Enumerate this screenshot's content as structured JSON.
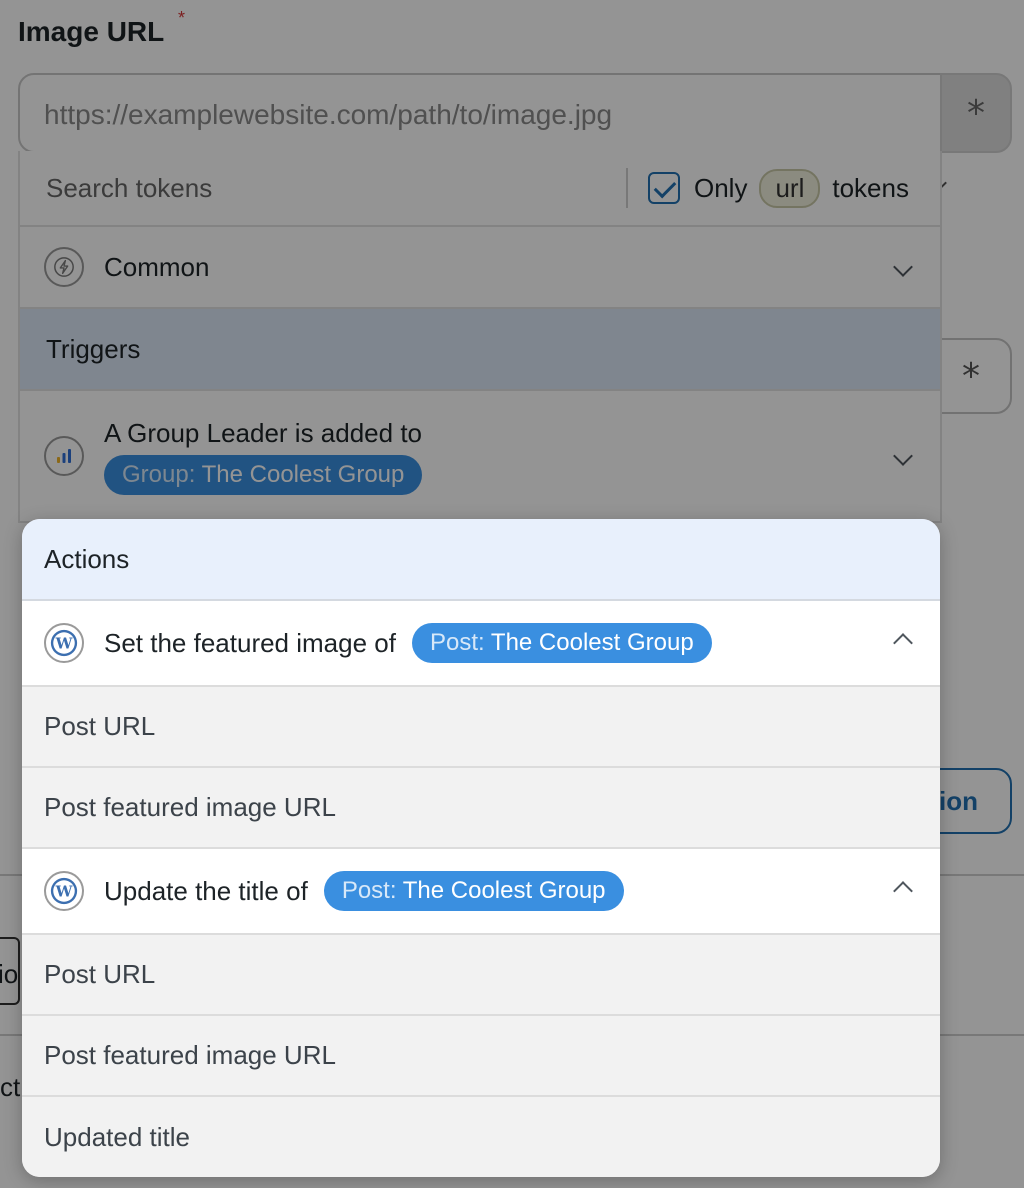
{
  "field": {
    "label": "Image URL",
    "required_mark": "*",
    "placeholder": "https://examplewebsite.com/path/to/image.jpg",
    "token_button": "*"
  },
  "background": {
    "token_button_2": "*",
    "action_button_partial": "ion",
    "left_tab_partial": "io",
    "left_text_partial": "ct"
  },
  "token_selector": {
    "search_placeholder": "Search tokens",
    "filter": {
      "prefix": "Only",
      "pill": "url",
      "suffix": "tokens",
      "checked": true
    },
    "groups": {
      "common": {
        "label": "Common",
        "icon": "bolt-icon"
      },
      "triggers": {
        "heading": "Triggers",
        "items": [
          {
            "label": "A Group Leader is added to",
            "badge_key": "Group:",
            "badge_value": "The Coolest Group",
            "icon": "learndash-icon"
          }
        ]
      },
      "actions": {
        "heading": "Actions",
        "items": [
          {
            "label": "Set the featured image of",
            "badge_key": "Post:",
            "badge_value": "The Coolest Group",
            "icon": "wordpress-icon",
            "tokens": [
              "Post URL",
              "Post featured image URL"
            ]
          },
          {
            "label": "Update the title of",
            "badge_key": "Post:",
            "badge_value": "The Coolest Group",
            "icon": "wordpress-icon",
            "tokens": [
              "Post URL",
              "Post featured image URL",
              "Updated title"
            ]
          }
        ]
      }
    }
  },
  "colors": {
    "accent": "#2271b1",
    "badge": "#3a8fe0",
    "triggers_header": "#dbe7f7",
    "actions_header": "#e8f0fc"
  }
}
